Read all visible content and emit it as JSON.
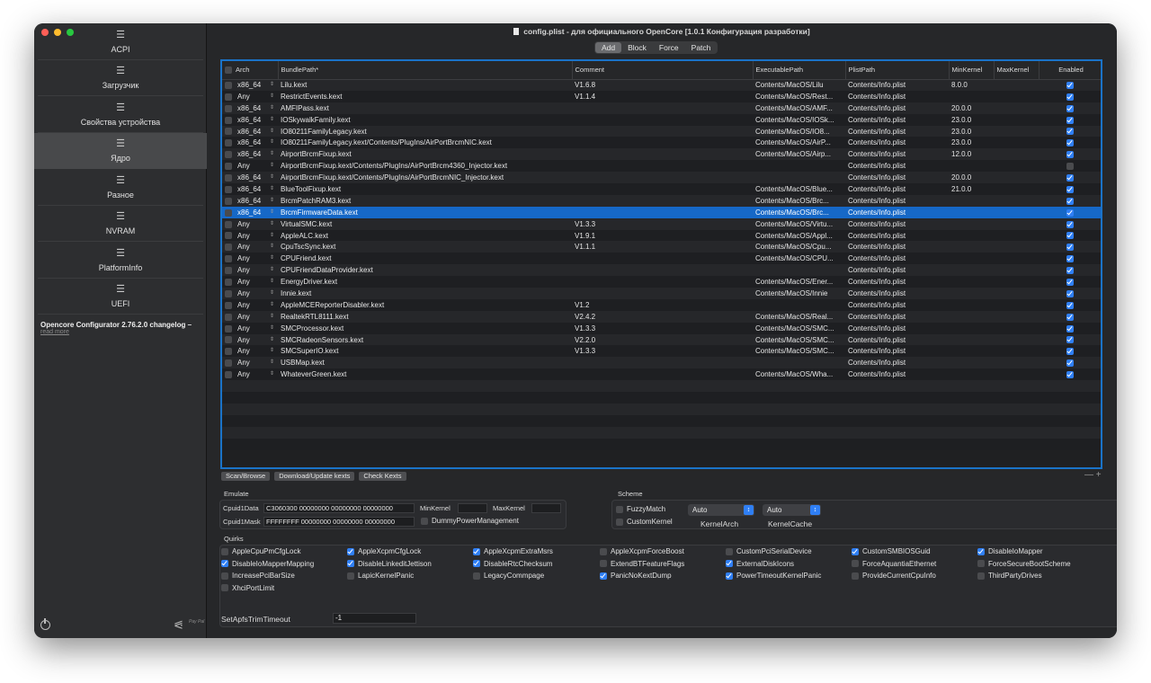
{
  "window": {
    "title": "config.plist - для официального OpenCore [1.0.1 Конфигурация разработки]"
  },
  "sidebar": {
    "items": [
      {
        "label": "ACPI",
        "icon": "list-icon"
      },
      {
        "label": "Загрузчик",
        "icon": "list-icon"
      },
      {
        "label": "Свойства устройства",
        "icon": "list-icon"
      },
      {
        "label": "Ядро",
        "icon": "list-icon",
        "active": true
      },
      {
        "label": "Разное",
        "icon": "list-icon"
      },
      {
        "label": "NVRAM",
        "icon": "list-icon"
      },
      {
        "label": "PlatformInfo",
        "icon": "list-icon"
      },
      {
        "label": "UEFI",
        "icon": "list-icon"
      }
    ],
    "changelog_title": "Opencore Configurator 2.76.2.0 changelog –",
    "changelog_link": "read more",
    "paypal_text": "Pay Pal"
  },
  "tabs": [
    "Add",
    "Block",
    "Force",
    "Patch"
  ],
  "active_tab": "Add",
  "table": {
    "columns": [
      "Arch",
      "BundlePath*",
      "Comment",
      "ExecutablePath",
      "PlistPath",
      "MinKernel",
      "MaxKernel",
      "Enabled"
    ],
    "rows": [
      {
        "arch": "x86_64",
        "bundle": "Lilu.kext",
        "comment": "V1.6.8",
        "exec": "Contents/MacOS/Lilu",
        "plist": "Contents/Info.plist",
        "min": "8.0.0",
        "max": "",
        "enabled": true
      },
      {
        "arch": "Any",
        "bundle": "RestrictEvents.kext",
        "comment": "V1.1.4",
        "exec": "Contents/MacOS/Rest...",
        "plist": "Contents/Info.plist",
        "min": "",
        "max": "",
        "enabled": true
      },
      {
        "arch": "x86_64",
        "bundle": "AMFIPass.kext",
        "comment": "",
        "exec": "Contents/MacOS/AMF...",
        "plist": "Contents/Info.plist",
        "min": "20.0.0",
        "max": "",
        "enabled": true
      },
      {
        "arch": "x86_64",
        "bundle": "IOSkywalkFamily.kext",
        "comment": "",
        "exec": "Contents/MacOS/IOSk...",
        "plist": "Contents/Info.plist",
        "min": "23.0.0",
        "max": "",
        "enabled": true
      },
      {
        "arch": "x86_64",
        "bundle": "IO80211FamilyLegacy.kext",
        "comment": "",
        "exec": "Contents/MacOS/IO8...",
        "plist": "Contents/Info.plist",
        "min": "23.0.0",
        "max": "",
        "enabled": true
      },
      {
        "arch": "x86_64",
        "bundle": "IO80211FamilyLegacy.kext/Contents/PlugIns/AirPortBrcmNIC.kext",
        "comment": "",
        "exec": "Contents/MacOS/AirP...",
        "plist": "Contents/Info.plist",
        "min": "23.0.0",
        "max": "",
        "enabled": true
      },
      {
        "arch": "x86_64",
        "bundle": "AirportBrcmFixup.kext",
        "comment": "",
        "exec": "Contents/MacOS/Airp...",
        "plist": "Contents/Info.plist",
        "min": "12.0.0",
        "max": "",
        "enabled": true
      },
      {
        "arch": "Any",
        "bundle": "AirportBrcmFixup.kext/Contents/PlugIns/AirPortBrcm4360_Injector.kext",
        "comment": "",
        "exec": "",
        "plist": "Contents/Info.plist",
        "min": "",
        "max": "",
        "enabled": false
      },
      {
        "arch": "x86_64",
        "bundle": "AirportBrcmFixup.kext/Contents/PlugIns/AirPortBrcmNIC_Injector.kext",
        "comment": "",
        "exec": "",
        "plist": "Contents/Info.plist",
        "min": "20.0.0",
        "max": "",
        "enabled": true
      },
      {
        "arch": "x86_64",
        "bundle": "BlueToolFixup.kext",
        "comment": "",
        "exec": "Contents/MacOS/Blue...",
        "plist": "Contents/Info.plist",
        "min": "21.0.0",
        "max": "",
        "enabled": true
      },
      {
        "arch": "x86_64",
        "bundle": "BrcmPatchRAM3.kext",
        "comment": "",
        "exec": "Contents/MacOS/Brc...",
        "plist": "Contents/Info.plist",
        "min": "",
        "max": "",
        "enabled": true
      },
      {
        "arch": "x86_64",
        "bundle": "BrcmFirmwareData.kext",
        "comment": "",
        "exec": "Contents/MacOS/Brc...",
        "plist": "Contents/Info.plist",
        "min": "",
        "max": "",
        "enabled": true,
        "selected": true
      },
      {
        "arch": "Any",
        "bundle": "VirtualSMC.kext",
        "comment": "V1.3.3",
        "exec": "Contents/MacOS/Virtu...",
        "plist": "Contents/Info.plist",
        "min": "",
        "max": "",
        "enabled": true
      },
      {
        "arch": "Any",
        "bundle": "AppleALC.kext",
        "comment": "V1.9.1",
        "exec": "Contents/MacOS/Appl...",
        "plist": "Contents/Info.plist",
        "min": "",
        "max": "",
        "enabled": true
      },
      {
        "arch": "Any",
        "bundle": "CpuTscSync.kext",
        "comment": "V1.1.1",
        "exec": "Contents/MacOS/Cpu...",
        "plist": "Contents/Info.plist",
        "min": "",
        "max": "",
        "enabled": true
      },
      {
        "arch": "Any",
        "bundle": "CPUFriend.kext",
        "comment": "",
        "exec": "Contents/MacOS/CPU...",
        "plist": "Contents/Info.plist",
        "min": "",
        "max": "",
        "enabled": true
      },
      {
        "arch": "Any",
        "bundle": "CPUFriendDataProvider.kext",
        "comment": "",
        "exec": "",
        "plist": "Contents/Info.plist",
        "min": "",
        "max": "",
        "enabled": true
      },
      {
        "arch": "Any",
        "bundle": "EnergyDriver.kext",
        "comment": "",
        "exec": "Contents/MacOS/Ener...",
        "plist": "Contents/Info.plist",
        "min": "",
        "max": "",
        "enabled": true
      },
      {
        "arch": "Any",
        "bundle": "Innie.kext",
        "comment": "",
        "exec": "Contents/MacOS/Innie",
        "plist": "Contents/Info.plist",
        "min": "",
        "max": "",
        "enabled": true
      },
      {
        "arch": "Any",
        "bundle": "AppleMCEReporterDisabler.kext",
        "comment": "V1.2",
        "exec": "",
        "plist": "Contents/Info.plist",
        "min": "",
        "max": "",
        "enabled": true
      },
      {
        "arch": "Any",
        "bundle": "RealtekRTL8111.kext",
        "comment": "V2.4.2",
        "exec": "Contents/MacOS/Real...",
        "plist": "Contents/Info.plist",
        "min": "",
        "max": "",
        "enabled": true
      },
      {
        "arch": "Any",
        "bundle": "SMCProcessor.kext",
        "comment": "V1.3.3",
        "exec": "Contents/MacOS/SMC...",
        "plist": "Contents/Info.plist",
        "min": "",
        "max": "",
        "enabled": true
      },
      {
        "arch": "Any",
        "bundle": "SMCRadeonSensors.kext",
        "comment": "V2.2.0",
        "exec": "Contents/MacOS/SMC...",
        "plist": "Contents/Info.plist",
        "min": "",
        "max": "",
        "enabled": true
      },
      {
        "arch": "Any",
        "bundle": "SMCSuperIO.kext",
        "comment": "V1.3.3",
        "exec": "Contents/MacOS/SMC...",
        "plist": "Contents/Info.plist",
        "min": "",
        "max": "",
        "enabled": true
      },
      {
        "arch": "Any",
        "bundle": "USBMap.kext",
        "comment": "",
        "exec": "",
        "plist": "Contents/Info.plist",
        "min": "",
        "max": "",
        "enabled": true
      },
      {
        "arch": "Any",
        "bundle": "WhateverGreen.kext",
        "comment": "",
        "exec": "Contents/MacOS/Wha...",
        "plist": "Contents/Info.plist",
        "min": "",
        "max": "",
        "enabled": true
      }
    ]
  },
  "buttons": {
    "scan": "Scan/Browse",
    "download": "Download/Update kexts",
    "check": "Check Kexts",
    "minus_plus": "— +"
  },
  "emulate": {
    "label": "Emulate",
    "cpuid1data_label": "Cpuid1Data",
    "cpuid1data_value": "C3060300 00000000 00000000 00000000",
    "cpuid1mask_label": "Cpuid1Mask",
    "cpuid1mask_value": "FFFFFFFF 00000000 00000000 00000000",
    "minkernel_label": "MinKernel",
    "maxkernel_label": "MaxKernel",
    "minkernel_value": "",
    "maxkernel_value": "",
    "dummy_label": "DummyPowerManagement",
    "dummy_checked": false
  },
  "scheme": {
    "label": "Scheme",
    "fuzzy_label": "FuzzyMatch",
    "fuzzy_checked": false,
    "custom_label": "CustomKernel",
    "custom_checked": false,
    "kernelarch_value": "Auto",
    "kernelarch_label": "KernelArch",
    "kernelcache_value": "Auto",
    "kernelcache_label": "KernelCache"
  },
  "quirks": {
    "label": "Quirks",
    "items": [
      {
        "label": "AppleCpuPmCfgLock",
        "checked": false
      },
      {
        "label": "AppleXcpmCfgLock",
        "checked": true
      },
      {
        "label": "AppleXcpmExtraMsrs",
        "checked": true
      },
      {
        "label": "AppleXcpmForceBoost",
        "checked": false
      },
      {
        "label": "CustomPciSerialDevice",
        "checked": false
      },
      {
        "label": "CustomSMBIOSGuid",
        "checked": true
      },
      {
        "label": "DisableIoMapper",
        "checked": true
      },
      {
        "label": "DisableIoMapperMapping",
        "checked": true
      },
      {
        "label": "DisableLinkeditJettison",
        "checked": true
      },
      {
        "label": "DisableRtcChecksum",
        "checked": true
      },
      {
        "label": "ExtendBTFeatureFlags",
        "checked": false
      },
      {
        "label": "ExternalDiskIcons",
        "checked": true
      },
      {
        "label": "ForceAquantiaEthernet",
        "checked": false
      },
      {
        "label": "ForceSecureBootScheme",
        "checked": false
      },
      {
        "label": "IncreasePciBarSize",
        "checked": false
      },
      {
        "label": "LapicKernelPanic",
        "checked": false
      },
      {
        "label": "LegacyCommpage",
        "checked": false
      },
      {
        "label": "PanicNoKextDump",
        "checked": true
      },
      {
        "label": "PowerTimeoutKernelPanic",
        "checked": true
      },
      {
        "label": "ProvideCurrentCpuInfo",
        "checked": false
      },
      {
        "label": "ThirdPartyDrives",
        "checked": false
      },
      {
        "label": "XhciPortLimit",
        "checked": false
      }
    ],
    "trim_label": "SetApfsTrimTimeout",
    "trim_value": "-1"
  },
  "colors": {
    "accent": "#2f7ff5",
    "selection": "#1668c7",
    "table_border": "#1a73c8"
  }
}
